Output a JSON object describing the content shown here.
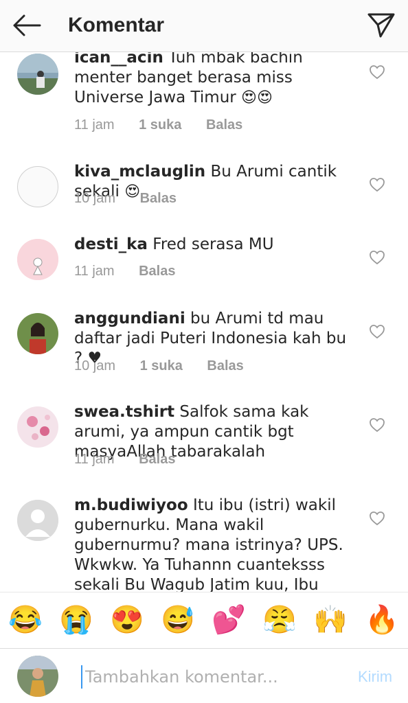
{
  "header": {
    "title": "Komentar",
    "back_icon": "arrow-left-icon",
    "send_icon": "paper-plane-icon"
  },
  "comments": [
    {
      "username": "ican__acin",
      "text": "Tuh mbak bachin menter banget berasa miss Universe Jawa Timur",
      "emoji": "😍😍",
      "time": "11 jam",
      "likes": "1 suka",
      "reply": "Balas"
    },
    {
      "username": "kiva_mclauglin",
      "text": "Bu Arumi cantik sekali",
      "emoji": "😍",
      "time": "10 jam",
      "likes": "",
      "reply": "Balas"
    },
    {
      "username": "desti_ka",
      "text": "Fred serasa MU",
      "emoji": "",
      "time": "11 jam",
      "likes": "",
      "reply": "Balas"
    },
    {
      "username": "anggundiani",
      "text": "bu Arumi td mau daftar jadi Puteri Indonesia kah bu ? ♥",
      "emoji": "",
      "time": "10 jam",
      "likes": "1 suka",
      "reply": "Balas"
    },
    {
      "username": "swea.tshirt",
      "text": "Salfok sama kak arumi, ya ampun cantik bgt masyaAllah tabarakalah",
      "emoji": "",
      "time": "11 jam",
      "likes": "",
      "reply": "Balas"
    },
    {
      "username": "m.budiwiyoo",
      "text": "Itu ibu (istri) wakil gubernurku. Mana wakil gubernurmu? mana istrinya? UPS. Wkwkw. Ya Tuhannn cuanteksss sekali Bu Wagub Jatim kuu, Ibu Arumi Bachsin Dardak.",
      "emoji": "😍",
      "time": "",
      "likes": "",
      "reply": ""
    }
  ],
  "emoji_bar": [
    "😂",
    "😭",
    "😍",
    "😅",
    "💕",
    "😤",
    "🙌",
    "🔥"
  ],
  "input": {
    "placeholder": "Tambahkan komentar...",
    "value": "",
    "post_label": "Kirim"
  },
  "colors": {
    "header_bg": "#fafafa",
    "text": "#262626",
    "meta": "#999999",
    "accent_disabled": "#b3dbff",
    "caret": "#3897f0"
  }
}
